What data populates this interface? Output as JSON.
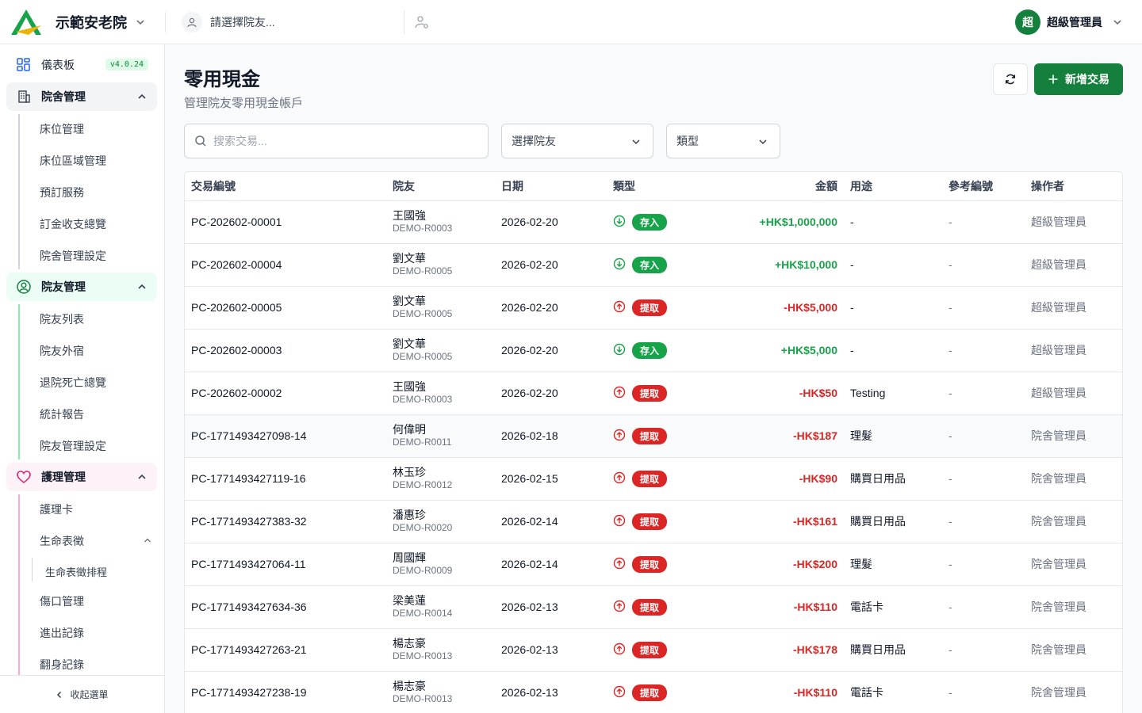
{
  "header": {
    "org_name": "示範安老院",
    "resident_placeholder": "請選擇院友...",
    "avatar_initial": "超",
    "admin_name": "超級管理員"
  },
  "sidebar": {
    "dashboard": {
      "label": "儀表板",
      "version": "v4.0.24"
    },
    "groups": [
      {
        "label": "院舍管理",
        "items": [
          "床位管理",
          "床位區域管理",
          "預訂服務",
          "訂金收支總覽",
          "院舍管理設定"
        ]
      },
      {
        "label": "院友管理",
        "items": [
          "院友列表",
          "院友外宿",
          "退院死亡總覽",
          "統計報告",
          "院友管理設定"
        ]
      },
      {
        "label": "護理管理",
        "items": [
          "護理卡",
          "生命表徵",
          "生命表徵排程",
          "傷口管理",
          "進出記錄",
          "翻身記錄"
        ]
      }
    ],
    "collapse_label": "收起選單"
  },
  "page": {
    "title": "零用現金",
    "subtitle": "管理院友零用現金帳戶",
    "add_button": "新增交易"
  },
  "filters": {
    "search_placeholder": "搜索交易...",
    "resident": "選擇院友",
    "type": "類型"
  },
  "table": {
    "columns": [
      "交易編號",
      "院友",
      "日期",
      "類型",
      "金額",
      "用途",
      "參考編號",
      "操作者"
    ],
    "rows": [
      {
        "id": "PC-202602-00001",
        "name": "王國強",
        "code": "DEMO-R0003",
        "date": "2026-02-20",
        "type": "存入",
        "dir": "in",
        "amount": "+HK$1,000,000",
        "purpose": "-",
        "ref": "-",
        "operator": "超級管理員"
      },
      {
        "id": "PC-202602-00004",
        "name": "劉文華",
        "code": "DEMO-R0005",
        "date": "2026-02-20",
        "type": "存入",
        "dir": "in",
        "amount": "+HK$10,000",
        "purpose": "-",
        "ref": "-",
        "operator": "超級管理員"
      },
      {
        "id": "PC-202602-00005",
        "name": "劉文華",
        "code": "DEMO-R0005",
        "date": "2026-02-20",
        "type": "提取",
        "dir": "out",
        "amount": "-HK$5,000",
        "purpose": "-",
        "ref": "-",
        "operator": "超級管理員"
      },
      {
        "id": "PC-202602-00003",
        "name": "劉文華",
        "code": "DEMO-R0005",
        "date": "2026-02-20",
        "type": "存入",
        "dir": "in",
        "amount": "+HK$5,000",
        "purpose": "-",
        "ref": "-",
        "operator": "超級管理員"
      },
      {
        "id": "PC-202602-00002",
        "name": "王國強",
        "code": "DEMO-R0003",
        "date": "2026-02-20",
        "type": "提取",
        "dir": "out",
        "amount": "-HK$50",
        "purpose": "Testing",
        "ref": "-",
        "operator": "超級管理員"
      },
      {
        "id": "PC-1771493427098-14",
        "name": "何偉明",
        "code": "DEMO-R0011",
        "date": "2026-02-18",
        "type": "提取",
        "dir": "out",
        "amount": "-HK$187",
        "purpose": "理髮",
        "ref": "-",
        "operator": "院舍管理員"
      },
      {
        "id": "PC-1771493427119-16",
        "name": "林玉珍",
        "code": "DEMO-R0012",
        "date": "2026-02-15",
        "type": "提取",
        "dir": "out",
        "amount": "-HK$90",
        "purpose": "購買日用品",
        "ref": "-",
        "operator": "院舍管理員"
      },
      {
        "id": "PC-1771493427383-32",
        "name": "潘惠珍",
        "code": "DEMO-R0020",
        "date": "2026-02-14",
        "type": "提取",
        "dir": "out",
        "amount": "-HK$161",
        "purpose": "購買日用品",
        "ref": "-",
        "operator": "院舍管理員"
      },
      {
        "id": "PC-1771493427064-11",
        "name": "周國輝",
        "code": "DEMO-R0009",
        "date": "2026-02-14",
        "type": "提取",
        "dir": "out",
        "amount": "-HK$200",
        "purpose": "理髮",
        "ref": "-",
        "operator": "院舍管理員"
      },
      {
        "id": "PC-1771493427634-36",
        "name": "梁美蓮",
        "code": "DEMO-R0014",
        "date": "2026-02-13",
        "type": "提取",
        "dir": "out",
        "amount": "-HK$110",
        "purpose": "電話卡",
        "ref": "-",
        "operator": "院舍管理員"
      },
      {
        "id": "PC-1771493427263-21",
        "name": "楊志豪",
        "code": "DEMO-R0013",
        "date": "2026-02-13",
        "type": "提取",
        "dir": "out",
        "amount": "-HK$178",
        "purpose": "購買日用品",
        "ref": "-",
        "operator": "院舍管理員"
      },
      {
        "id": "PC-1771493427238-19",
        "name": "楊志豪",
        "code": "DEMO-R0013",
        "date": "2026-02-13",
        "type": "提取",
        "dir": "out",
        "amount": "-HK$110",
        "purpose": "電話卡",
        "ref": "-",
        "operator": "院舍管理員"
      }
    ]
  },
  "colors": {
    "brand_green": "#15803d",
    "deposit": "#16a34a",
    "withdraw": "#dc2626",
    "pink_accent": "#ec4899",
    "green_accent": "#22c55e"
  }
}
